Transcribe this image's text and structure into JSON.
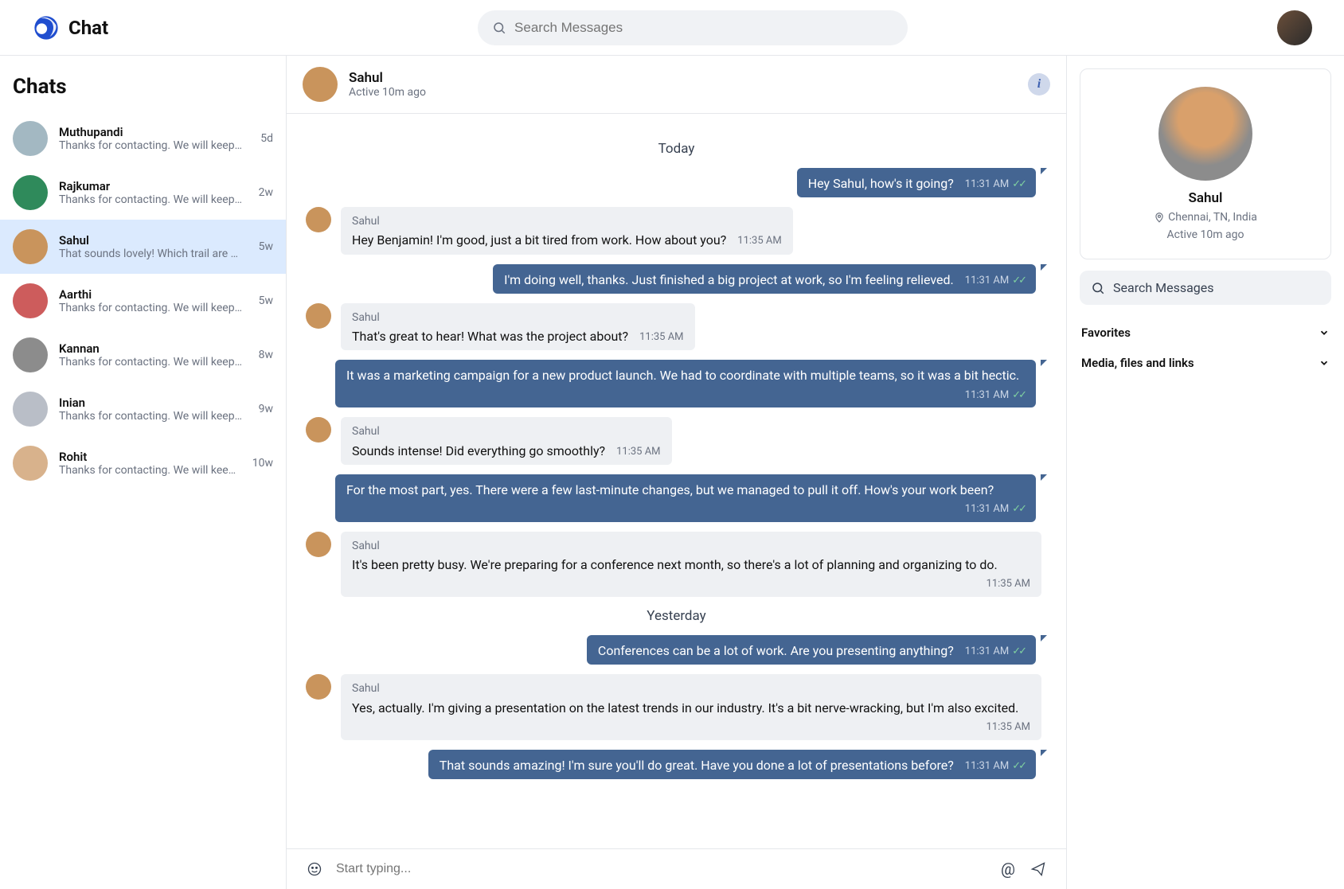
{
  "header": {
    "app_name": "Chat",
    "search_placeholder": "Search Messages"
  },
  "sidebar": {
    "title": "Chats",
    "chats": [
      {
        "name": "Muthupandi",
        "preview": "Thanks for contacting. We will keep in ...",
        "time": "5d",
        "active": false
      },
      {
        "name": "Rajkumar",
        "preview": "Thanks for contacting. We will keep in ...",
        "time": "2w",
        "active": false
      },
      {
        "name": "Sahul",
        "preview": "That sounds lovely! Which trail are you ...",
        "time": "5w",
        "active": true
      },
      {
        "name": "Aarthi",
        "preview": "Thanks for contacting. We will keep in ...",
        "time": "5w",
        "active": false
      },
      {
        "name": "Kannan",
        "preview": "Thanks for contacting. We will keep in ...",
        "time": "8w",
        "active": false
      },
      {
        "name": "Inian",
        "preview": "Thanks for contacting. We will keep in ...",
        "time": "9w",
        "active": false
      },
      {
        "name": "Rohit",
        "preview": "Thanks for contacting. We will keep in ...",
        "time": "10w",
        "active": false
      }
    ]
  },
  "conversation": {
    "header": {
      "name": "Sahul",
      "status": "Active 10m ago"
    },
    "items": [
      {
        "kind": "sep",
        "label": "Today"
      },
      {
        "kind": "msg",
        "dir": "out",
        "text": "Hey Sahul, how's it going?",
        "time": "11:31 AM",
        "read": true
      },
      {
        "kind": "msg",
        "dir": "in",
        "sender": "Sahul",
        "text": "Hey Benjamin! I'm good, just a bit tired from work. How about you?",
        "time": "11:35 AM"
      },
      {
        "kind": "msg",
        "dir": "out",
        "text": "I'm doing well, thanks. Just finished a big project at work, so I'm feeling relieved.",
        "time": "11:31 AM",
        "read": true
      },
      {
        "kind": "msg",
        "dir": "in",
        "sender": "Sahul",
        "text": "That's great to hear! What was the project about?",
        "time": "11:35 AM"
      },
      {
        "kind": "msg",
        "dir": "out",
        "text": "It was a marketing campaign for a new product launch. We had to coordinate with multiple teams, so it was a bit hectic.",
        "time": "11:31 AM",
        "read": true
      },
      {
        "kind": "msg",
        "dir": "in",
        "sender": "Sahul",
        "text": "Sounds intense! Did everything go smoothly?",
        "time": "11:35 AM"
      },
      {
        "kind": "msg",
        "dir": "out",
        "text": "For the most part, yes. There were a few last-minute changes, but we managed to pull it off. How's your work been?",
        "time": "11:31 AM",
        "read": true
      },
      {
        "kind": "msg",
        "dir": "in",
        "sender": "Sahul",
        "text": "It's been pretty busy. We're preparing for a conference next month, so there's a lot of planning and organizing to do.",
        "time": "11:35 AM"
      },
      {
        "kind": "sep",
        "label": "Yesterday"
      },
      {
        "kind": "msg",
        "dir": "out",
        "text": "Conferences can be a lot of work. Are you presenting anything?",
        "time": "11:31 AM",
        "read": true
      },
      {
        "kind": "msg",
        "dir": "in",
        "sender": "Sahul",
        "text": "Yes, actually. I'm giving a presentation on the latest trends in our industry. It's a bit nerve-wracking, but I'm also excited.",
        "time": "11:35 AM"
      },
      {
        "kind": "msg",
        "dir": "out",
        "text": "That sounds amazing! I'm sure you'll do great. Have you done a lot of presentations before?",
        "time": "11:31 AM",
        "read": true
      }
    ],
    "composer_placeholder": "Start typing..."
  },
  "right_panel": {
    "name": "Sahul",
    "location": "Chennai, TN, India",
    "active": "Active 10m ago",
    "search_label": "Search Messages",
    "sections": [
      {
        "label": "Favorites"
      },
      {
        "label": "Media, files and links"
      }
    ]
  },
  "avatar_colors": [
    "#a3b8c2",
    "#2f8a5b",
    "#c9945c",
    "#cd5c5c",
    "#8c8c8c",
    "#b9bec7",
    "#d8b28c"
  ]
}
